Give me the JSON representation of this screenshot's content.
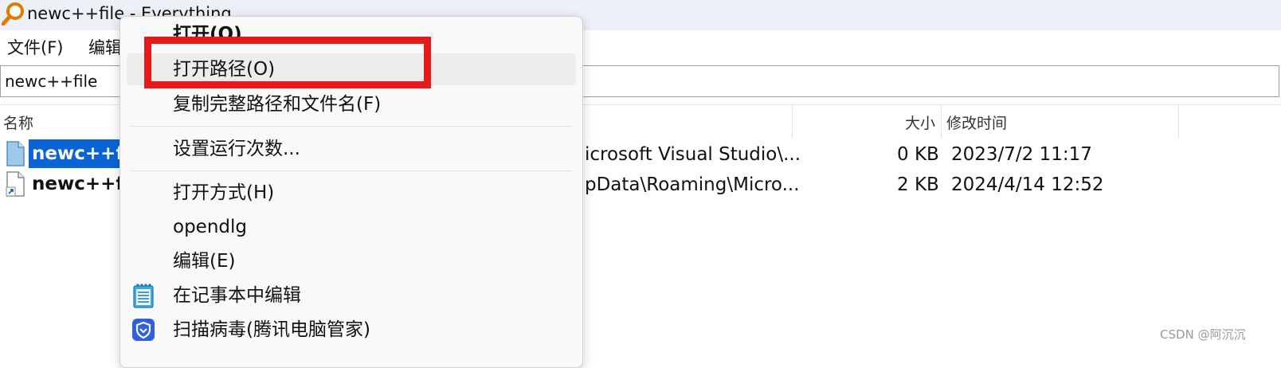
{
  "window": {
    "title": "newc++file - Everything"
  },
  "menubar": {
    "items": [
      "文件(F)",
      "编辑"
    ]
  },
  "search": {
    "value": "newc++file"
  },
  "columns": {
    "name": "名称",
    "size": "大小",
    "modified": "修改时间"
  },
  "rows": [
    {
      "name": "newc++fi",
      "path": "icrosoft Visual Studio\\...",
      "size": "0 KB",
      "modified": "2023/7/2 11:17",
      "selected": true
    },
    {
      "name": "newc++fi",
      "path": "pData\\Roaming\\Micro...",
      "size": "2 KB",
      "modified": "2024/4/14 12:52",
      "selected": false
    }
  ],
  "context_menu": {
    "open": "打开(O)",
    "open_path": "打开路径(O)",
    "copy_full_path": "复制完整路径和文件名(F)",
    "set_run_count": "设置运行次数...",
    "open_with": "打开方式(H)",
    "opendlg": "opendlg",
    "edit": "编辑(E)",
    "edit_in_notepad": "在记事本中编辑",
    "scan_virus": "扫描病毒(腾讯电脑管家)"
  },
  "colors": {
    "highlight_box": "#e31b1b",
    "selection": "#0a64d6",
    "menu_bg": "#f9f9f9"
  },
  "watermark": "CSDN @阿沉沉"
}
